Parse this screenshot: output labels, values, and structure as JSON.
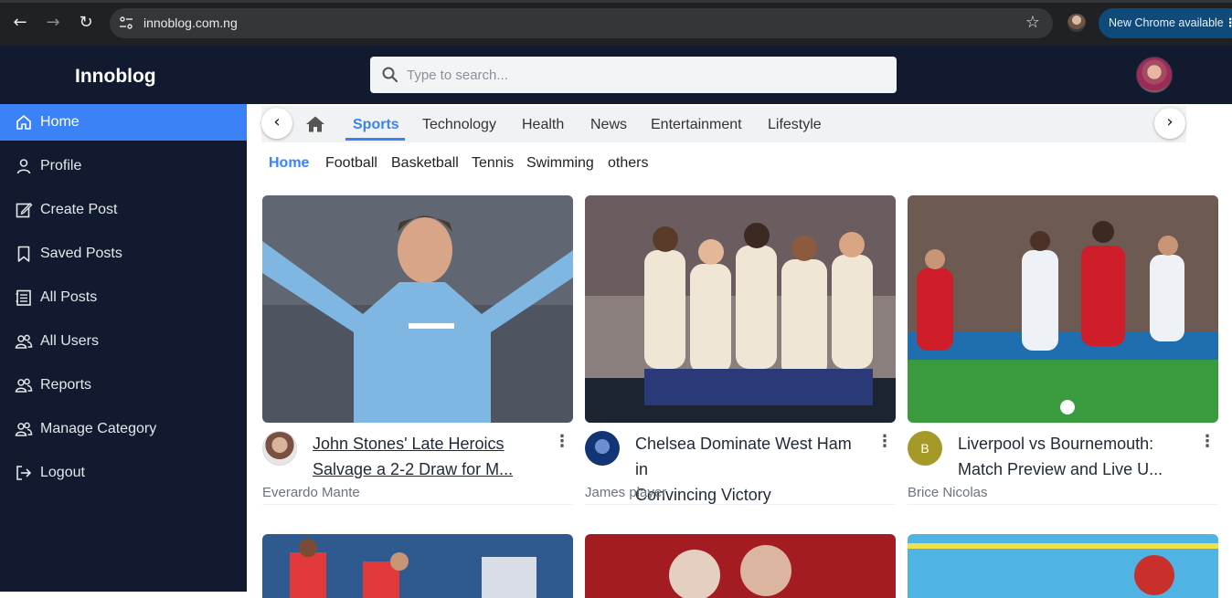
{
  "browser": {
    "url": "innoblog.com.ng",
    "update_label": "New Chrome available",
    "colors": {
      "frame": "#202124",
      "omnibox": "#35363a",
      "update": "#0e4b7a"
    }
  },
  "header": {
    "brand": "Innoblog",
    "search_placeholder": "Type to search..."
  },
  "sidebar": {
    "items": [
      {
        "label": "Home",
        "icon": "home-icon",
        "active": true
      },
      {
        "label": "Profile",
        "icon": "user-icon"
      },
      {
        "label": "Create Post",
        "icon": "edit-icon"
      },
      {
        "label": "Saved Posts",
        "icon": "bookmark-icon"
      },
      {
        "label": "All Posts",
        "icon": "list-icon"
      },
      {
        "label": "All Users",
        "icon": "users-icon"
      },
      {
        "label": "Reports",
        "icon": "users-icon"
      },
      {
        "label": "Manage Category",
        "icon": "users-icon"
      },
      {
        "label": "Logout",
        "icon": "logout-icon"
      }
    ]
  },
  "categories": {
    "active": "Sports",
    "items": [
      "Sports",
      "Technology",
      "Health",
      "News",
      "Entertainment",
      "Lifestyle"
    ]
  },
  "subcategories": {
    "active": "Home",
    "items": [
      "Home",
      "Football",
      "Basketball",
      "Tennis",
      "Swimming",
      "others"
    ]
  },
  "posts": [
    {
      "title_line1": "John Stones' Late Heroics",
      "title_line2": "Salvage a 2-2 Draw for M...",
      "author": "Everardo Mante"
    },
    {
      "title_line1": "Chelsea Dominate West Ham in",
      "title_line2": "Convincing Victory",
      "author": "James player"
    },
    {
      "title_line1": "Liverpool vs Bournemouth:",
      "title_line2": "Match Preview and Live U...",
      "author": "Brice Nicolas",
      "avatar_initial": "B"
    }
  ],
  "colors": {
    "sidebar_bg": "#111a2e",
    "accent": "#3b82f6",
    "initial_avatar": "#a59a27"
  }
}
